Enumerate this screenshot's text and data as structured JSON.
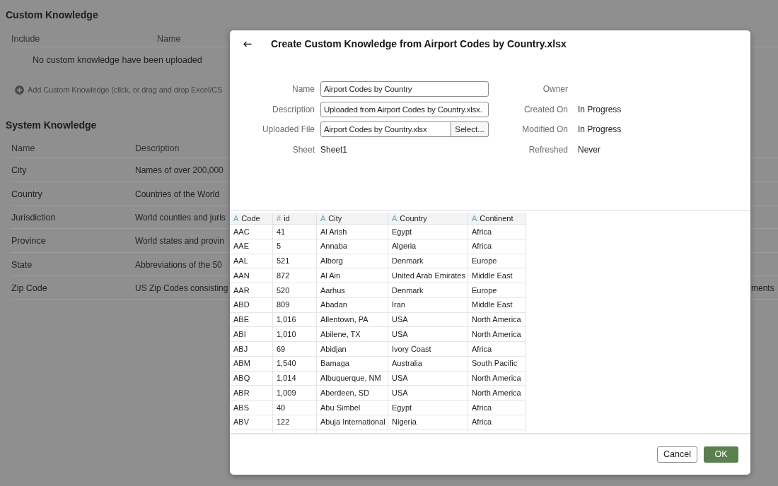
{
  "page": {
    "custom_knowledge": {
      "title": "Custom Knowledge",
      "columns": [
        "Include",
        "Name"
      ],
      "empty_message": "No custom knowledge have been uploaded",
      "add_action": "Add Custom Knowledge (click, or drag and drop Excel/CS"
    },
    "system_knowledge": {
      "title": "System Knowledge",
      "columns": [
        "Name",
        "Description"
      ],
      "rows": [
        {
          "name": "City",
          "description": "Names of over 200,000"
        },
        {
          "name": "Country",
          "description": "Countries of the World"
        },
        {
          "name": "Jurisdiction",
          "description": "World counties and juris"
        },
        {
          "name": "Province",
          "description": "World states and provin"
        },
        {
          "name": "State",
          "description": "Abbreviations of the 50"
        },
        {
          "name": "Zip Code",
          "description": "US Zip Codes consisting",
          "description_tail": "ments"
        }
      ]
    }
  },
  "dialog": {
    "title": "Create Custom Knowledge from Airport Codes by Country.xlsx",
    "fields_left": [
      {
        "label": "Name",
        "kind": "input",
        "value": "Airport Codes by Country"
      },
      {
        "label": "Description",
        "kind": "input",
        "value": "Uploaded from Airport Codes by Country.xlsx."
      },
      {
        "label": "Uploaded File",
        "kind": "file",
        "value": "Airport Codes by Country.xlsx",
        "button": "Select..."
      },
      {
        "label": "Sheet",
        "kind": "text",
        "value": "Sheet1"
      }
    ],
    "fields_right": [
      {
        "label": "Owner"
      },
      {
        "label": "Created On",
        "value": "In Progress"
      },
      {
        "label": "Modified On",
        "value": "In Progress"
      },
      {
        "label": "Refreshed",
        "value": "Never"
      }
    ],
    "preview_table": {
      "columns": [
        {
          "label": "Code",
          "kind": "text",
          "type_glyph": "A"
        },
        {
          "label": "id",
          "kind": "number",
          "type_glyph": "#"
        },
        {
          "label": "City",
          "kind": "text",
          "type_glyph": "A"
        },
        {
          "label": "Country",
          "kind": "text",
          "type_glyph": "A"
        },
        {
          "label": "Continent",
          "kind": "text",
          "type_glyph": "A"
        }
      ],
      "rows": [
        [
          "AAC",
          "41",
          "Al Arish",
          "Egypt",
          "Africa"
        ],
        [
          "AAE",
          "5",
          "Annaba",
          "Algeria",
          "Africa"
        ],
        [
          "AAL",
          "521",
          "Alborg",
          "Denmark",
          "Europe"
        ],
        [
          "AAN",
          "872",
          "Al Ain",
          "United Arab Emirates",
          "Middle East"
        ],
        [
          "AAR",
          "520",
          "Aarhus",
          "Denmark",
          "Europe"
        ],
        [
          "ABD",
          "809",
          "Abadan",
          "Iran",
          "Middle East"
        ],
        [
          "ABE",
          "1,016",
          "Allentown, PA",
          "USA",
          "North America"
        ],
        [
          "ABI",
          "1,010",
          "Abilene, TX",
          "USA",
          "North America"
        ],
        [
          "ABJ",
          "69",
          "Abidjan",
          "Ivory Coast",
          "Africa"
        ],
        [
          "ABM",
          "1,540",
          "Bamaga",
          "Australia",
          "South Pacific"
        ],
        [
          "ABQ",
          "1,014",
          "Albuquerque, NM",
          "USA",
          "North America"
        ],
        [
          "ABR",
          "1,009",
          "Aberdeen, SD",
          "USA",
          "North America"
        ],
        [
          "ABS",
          "40",
          "Abu Simbel",
          "Egypt",
          "Africa"
        ],
        [
          "ABV",
          "122",
          "Abuja International",
          "Nigeria",
          "Africa"
        ]
      ]
    },
    "buttons": [
      {
        "label": "Cancel",
        "kind": "secondary"
      },
      {
        "label": "OK",
        "kind": "primary"
      }
    ]
  }
}
